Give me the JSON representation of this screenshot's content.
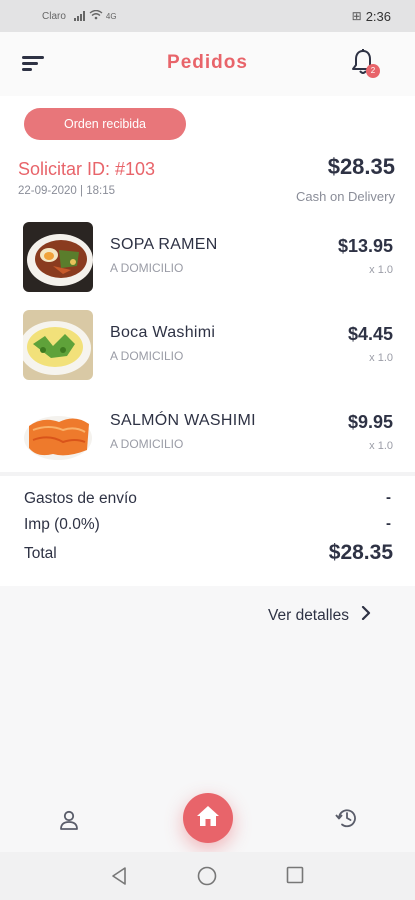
{
  "status_bar": {
    "carrier": "Claro",
    "network": "4G",
    "battery": "⊞",
    "time": "2:36"
  },
  "header": {
    "title": "Pedidos",
    "notification_count": "2"
  },
  "order": {
    "status": "Orden recibida",
    "id_label": "Solicitar ID: #103",
    "date": "22-09-2020 | 18:15",
    "total": "$28.35",
    "payment_method": "Cash on Delivery"
  },
  "items": [
    {
      "name": "SOPA RAMEN",
      "type": "A DOMICILIO",
      "price": "$13.95",
      "qty": "x 1.0"
    },
    {
      "name": "Boca Washimi",
      "type": "A DOMICILIO",
      "price": "$4.45",
      "qty": "x 1.0"
    },
    {
      "name": "SALMÓN WASHIMI",
      "type": "A DOMICILIO",
      "price": "$9.95",
      "qty": "x 1.0"
    }
  ],
  "summary": {
    "shipping_label": "Gastos de envío",
    "shipping_value": "-",
    "tax_label": "Imp (0.0%)",
    "tax_value": "-",
    "total_label": "Total",
    "total_value": "$28.35"
  },
  "details_link": "Ver detalles",
  "colors": {
    "accent": "#e8646a",
    "text": "#2e3244",
    "muted": "#8a8d98"
  },
  "icons": {
    "menu": "menu-icon",
    "bell": "bell-icon",
    "user": "user-icon",
    "home": "home-icon",
    "history": "history-icon",
    "chevron": "chevron-right-icon"
  }
}
